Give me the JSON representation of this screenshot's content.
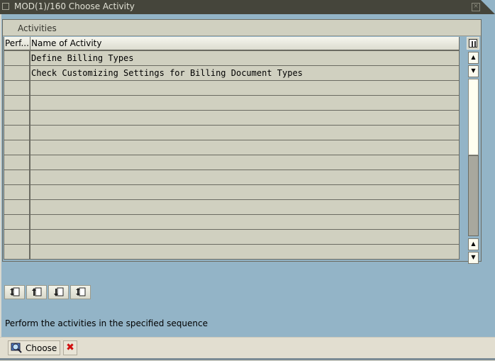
{
  "window": {
    "title": "MOD(1)/160 Choose Activity",
    "close_icon": "close-icon"
  },
  "panel": {
    "caption": "Activities",
    "columns": [
      "Perf...",
      "Name of Activity"
    ],
    "rows": [
      {
        "perf": "",
        "name": "Define Billing Types"
      },
      {
        "perf": "",
        "name": "Check Customizing Settings for Billing Document Types"
      },
      {
        "perf": "",
        "name": ""
      },
      {
        "perf": "",
        "name": ""
      },
      {
        "perf": "",
        "name": ""
      },
      {
        "perf": "",
        "name": ""
      },
      {
        "perf": "",
        "name": ""
      },
      {
        "perf": "",
        "name": ""
      },
      {
        "perf": "",
        "name": ""
      },
      {
        "perf": "",
        "name": ""
      },
      {
        "perf": "",
        "name": ""
      },
      {
        "perf": "",
        "name": ""
      },
      {
        "perf": "",
        "name": ""
      },
      {
        "perf": "",
        "name": ""
      }
    ]
  },
  "toolbar": {
    "buttons": [
      "first-page-icon",
      "previous-page-icon",
      "next-page-icon",
      "last-page-icon"
    ]
  },
  "hint": "Perform the activities in the specified sequence",
  "footer": {
    "choose_label": "Choose",
    "cancel_icon": "cancel-icon"
  }
}
